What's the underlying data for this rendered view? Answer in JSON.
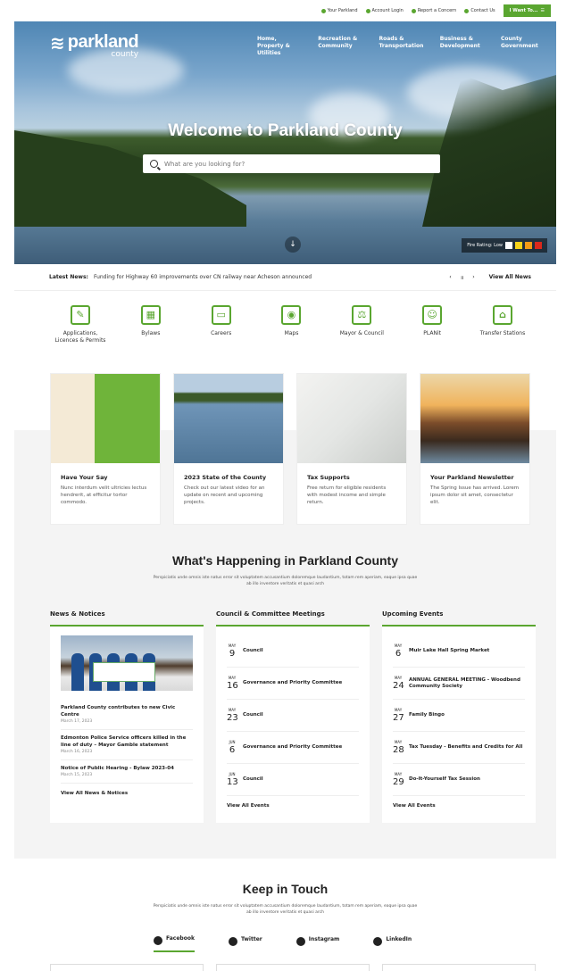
{
  "util": {
    "links": [
      "Your Parkland",
      "Account Login",
      "Report a Concern",
      "Contact Us"
    ],
    "cta": "I Want To..."
  },
  "logo": {
    "word": "parkland",
    "sub": "county"
  },
  "nav": [
    "Home, Property & Utilities",
    "Recreation & Community",
    "Roads & Transportation",
    "Business & Development",
    "County Government"
  ],
  "hero": {
    "title": "Welcome to Parkland County",
    "search_placeholder": "What are you looking for?",
    "fire_label": "Fire Rating: Low"
  },
  "colors": {
    "accent": "#5aa630",
    "fire": [
      "#ffffff",
      "#f6d31b",
      "#f29a16",
      "#d9291c"
    ]
  },
  "ticker": {
    "label": "Latest News:",
    "message": "Funding for Highway 60 improvements over CN railway near Acheson announced",
    "view_all": "View All News"
  },
  "quick": [
    {
      "label": "Applications, Licences & Permits",
      "icon": "pencil-doc-icon"
    },
    {
      "label": "Bylaws",
      "icon": "calendar-icon"
    },
    {
      "label": "Careers",
      "icon": "briefcase-icon"
    },
    {
      "label": "Maps",
      "icon": "map-icon"
    },
    {
      "label": "Mayor & Council",
      "icon": "gavel-icon"
    },
    {
      "label": "PLANit",
      "icon": "worker-icon"
    },
    {
      "label": "Transfer Stations",
      "icon": "building-icon"
    }
  ],
  "cards": [
    {
      "title": "Have Your Say",
      "desc": "Nunc interdum velit ultricies lectus hendrerit, at efficitur tortor commodo."
    },
    {
      "title": "2023 State of the County",
      "desc": "Check out our latest video for an update on recent and upcoming projects."
    },
    {
      "title": "Tax Supports",
      "desc": "Free return for eligible residents with modest income and simple return."
    },
    {
      "title": "Your Parkland Newsletter",
      "desc": "The Spring Issue has arrived. Lorem ipsum dolor sit amet, consectetur elit."
    }
  ],
  "happening": {
    "title": "What's Happening in Parkland County",
    "lorem": "Perspiciatis unde omnis iste natus error sit voluptatem accusantium doloremque laudantium, totam rem aperiam, eaque ipsa quae ab illo inventore veritatis et quasi arch"
  },
  "news": {
    "title": "News & Notices",
    "items": [
      {
        "h": "Parkland County contributes to new Civic Centre",
        "d": "March 17, 2023"
      },
      {
        "h": "Edmonton Police Service officers killed in the line of duty – Mayor Gamble statement",
        "d": "March 16, 2023"
      },
      {
        "h": "Notice of Public Hearing - Bylaw 2023-04",
        "d": "March 15, 2023"
      }
    ],
    "view_all": "View All News & Notices"
  },
  "meetings": {
    "title": "Council & Committee Meetings",
    "items": [
      {
        "m": "MAY",
        "d": "9",
        "n": "Council"
      },
      {
        "m": "MAY",
        "d": "16",
        "n": "Governance and Priority Committee"
      },
      {
        "m": "MAY",
        "d": "23",
        "n": "Council"
      },
      {
        "m": "JUN",
        "d": "6",
        "n": "Governance and Priority Committee"
      },
      {
        "m": "JUN",
        "d": "13",
        "n": "Council"
      }
    ],
    "view_all": "View All Events"
  },
  "events": {
    "title": "Upcoming Events",
    "items": [
      {
        "m": "MAY",
        "d": "6",
        "n": "Muir Lake Hall Spring Market"
      },
      {
        "m": "MAY",
        "d": "24",
        "n": "ANNUAL GENERAL MEETING - Woodbend Community Society"
      },
      {
        "m": "MAY",
        "d": "27",
        "n": "Family Bingo"
      },
      {
        "m": "MAY",
        "d": "28",
        "n": "Tax Tuesday - Benefits and Credits for All"
      },
      {
        "m": "MAY",
        "d": "29",
        "n": "Do-It-Yourself Tax Session"
      }
    ],
    "view_all": "View All Events"
  },
  "keep": {
    "title": "Keep in Touch",
    "lorem": "Perspiciatis unde omnis iste natus error sit voluptatem accusantium doloremque laudantium, totam rem aperiam, eaque ipsa quae ab illo inventore veritatis et quasi arch",
    "socials": [
      "Facebook",
      "Twitter",
      "Instagram",
      "LinkedIn"
    ]
  }
}
